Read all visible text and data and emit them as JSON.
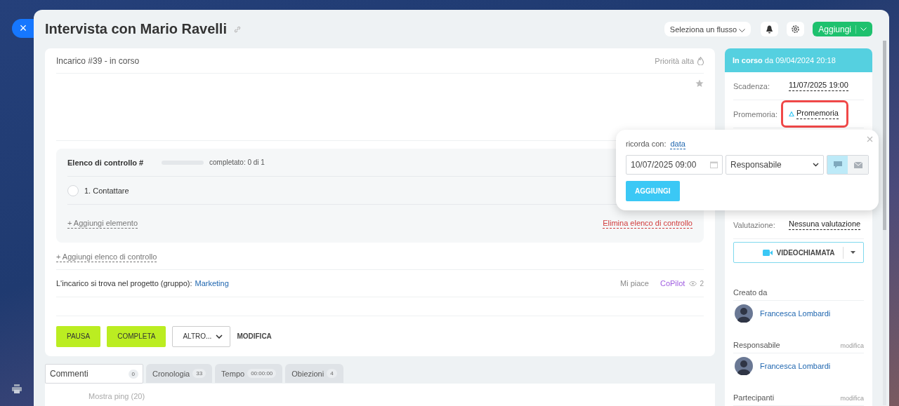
{
  "close_button": {
    "label": "×"
  },
  "title": "Intervista con Mario Ravelli",
  "header": {
    "flow_select": "Seleziona un flusso",
    "add_button": "Aggiungi"
  },
  "task": {
    "status": "Incarico #39 - in corso",
    "priority": "Priorità alta",
    "checklist": {
      "title": "Elenco di controllo #",
      "level": 0,
      "progress": "completato: 0 di 1",
      "items": [
        {
          "label": "1. Contattare",
          "checked": false
        }
      ],
      "add_item": "+ Aggiungi elemento",
      "delete": "Elimina elenco di controllo"
    },
    "add_checklist": "+ Aggiungi elenco di controllo",
    "project_label": "L'incarico si trova nel progetto (gruppo):",
    "project": "Marketing",
    "like": "Mi piace",
    "copilot": "CoPilot",
    "views": "2"
  },
  "actions": [
    {
      "label": "PAUSA",
      "kind": "primary"
    },
    {
      "label": "COMPLETA",
      "kind": "primary"
    },
    {
      "label": "ALTRO...",
      "kind": "dropdown"
    },
    {
      "label": "MODIFICA",
      "kind": "link"
    }
  ],
  "tabs": [
    {
      "label": "Commenti",
      "count": "0",
      "selected": true
    },
    {
      "label": "Cronologia",
      "count": "33",
      "selected": false
    },
    {
      "label": "Tempo",
      "count": "00:00:00",
      "selected": false
    },
    {
      "label": "Obiezioni",
      "count": "4",
      "selected": false
    }
  ],
  "comments": {
    "show_pings": "Mostra ping (20)"
  },
  "sidebar": {
    "status": "**In corso** da 09/04/2024 20:18",
    "fields": [
      {
        "label": "Scadenza:",
        "value": "11/07/2025 19:00",
        "highlighted": false
      },
      {
        "label": "Promemoria:",
        "value": "Promemoria",
        "highlighted": true
      }
    ],
    "rating": {
      "label": "Valutazione:",
      "value": "Nessuna valutazione"
    },
    "videocall": "VIDEOCHIAMATA",
    "sections": [
      {
        "title": "Creato da",
        "people": [
          {
            "name": "Francesca Lombardi"
          }
        ]
      },
      {
        "title": "Responsabile",
        "action": "modifica",
        "people": [
          {
            "name": "Francesca Lombardi"
          }
        ]
      },
      {
        "title": "Partecipanti",
        "action": "modifica"
      }
    ]
  },
  "popup": {
    "label": "ricorda con:",
    "mode": "data",
    "date": "10/07/2025 09:00",
    "recipient": "Responsabile",
    "channels": [
      {
        "kind": "chat",
        "selected": true
      },
      {
        "kind": "mail",
        "selected": false
      }
    ],
    "submit": "AGGIUNGI"
  }
}
